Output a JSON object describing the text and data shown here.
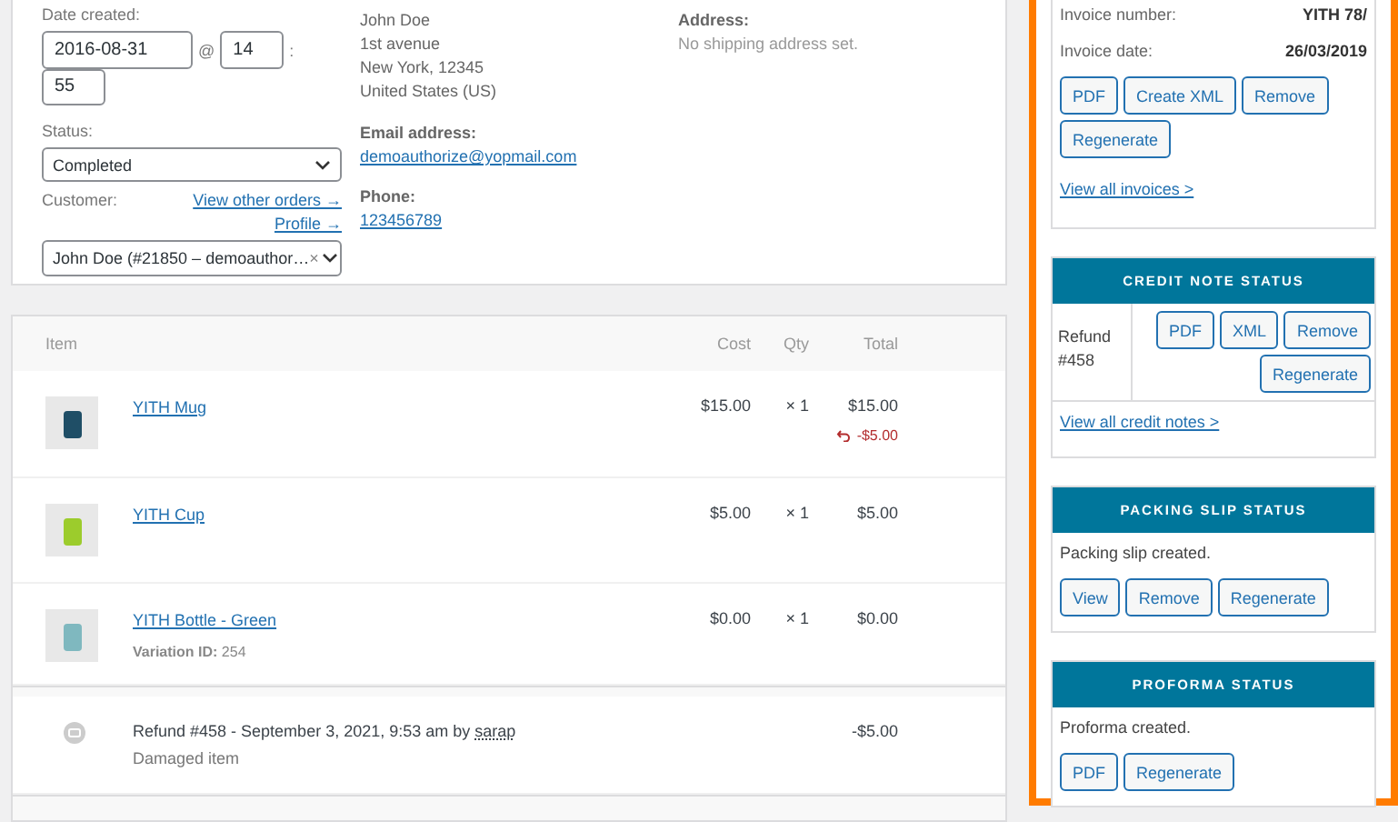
{
  "order_details": {
    "date_created": {
      "label": "Date created:",
      "date": "2016-08-31",
      "at": "@",
      "hour": "14",
      "colon": ":",
      "minute": "55"
    },
    "status": {
      "label": "Status:",
      "value": "Completed"
    },
    "customer": {
      "label": "Customer:",
      "links": [
        "View other orders →",
        "Profile →"
      ],
      "value": "John Doe (#21850 – demoauthor…",
      "clear": "×"
    },
    "billing": {
      "address_lines": [
        "John Doe",
        "1st avenue",
        "New York, 12345",
        "United States (US)"
      ],
      "email_label": "Email address:",
      "email": "demoauthorize@yopmail.com",
      "phone_label": "Phone:",
      "phone": "123456789"
    },
    "shipping": {
      "label": "Address:",
      "note": "No shipping address set."
    }
  },
  "items": {
    "columns": [
      "Item",
      "Cost",
      "Qty",
      "Total"
    ],
    "rows": [
      {
        "kind": "product",
        "name": "YITH Mug",
        "cost": "$15.00",
        "qty": "× 1",
        "total": "$15.00",
        "refund": "-$5.00"
      },
      {
        "kind": "product",
        "name": "YITH Cup",
        "cost": "$5.00",
        "qty": "× 1",
        "total": "$5.00"
      },
      {
        "kind": "product",
        "name": "YITH Bottle - Green",
        "meta_label": "Variation ID:",
        "meta_value": "254",
        "cost": "$0.00",
        "qty": "× 1",
        "total": "$0.00"
      },
      {
        "kind": "refund",
        "title": "Refund #458 - September 3, 2021, 9:53 am by",
        "user": "sarap",
        "reason": "Damaged item",
        "total": "-$5.00"
      }
    ]
  },
  "sidebar": {
    "invoice": {
      "fields": [
        {
          "label": "Invoice number:",
          "value": "YITH 78/"
        },
        {
          "label": "Invoice date:",
          "value": "26/03/2019"
        }
      ],
      "buttons": [
        "PDF",
        "Create XML",
        "Remove",
        "Regenerate"
      ],
      "link": "View all invoices >"
    },
    "credit_note": {
      "title": "CREDIT NOTE STATUS",
      "refund": "Refund #458",
      "buttons": [
        "PDF",
        "XML",
        "Remove",
        "Regenerate"
      ],
      "link": "View all credit notes >"
    },
    "packing_slip": {
      "title": "PACKING SLIP STATUS",
      "note": "Packing slip created.",
      "buttons": [
        "View",
        "Remove",
        "Regenerate"
      ]
    },
    "proforma": {
      "title": "PROFORMA STATUS",
      "note": "Proforma created.",
      "buttons": [
        "PDF",
        "Regenerate"
      ]
    }
  }
}
